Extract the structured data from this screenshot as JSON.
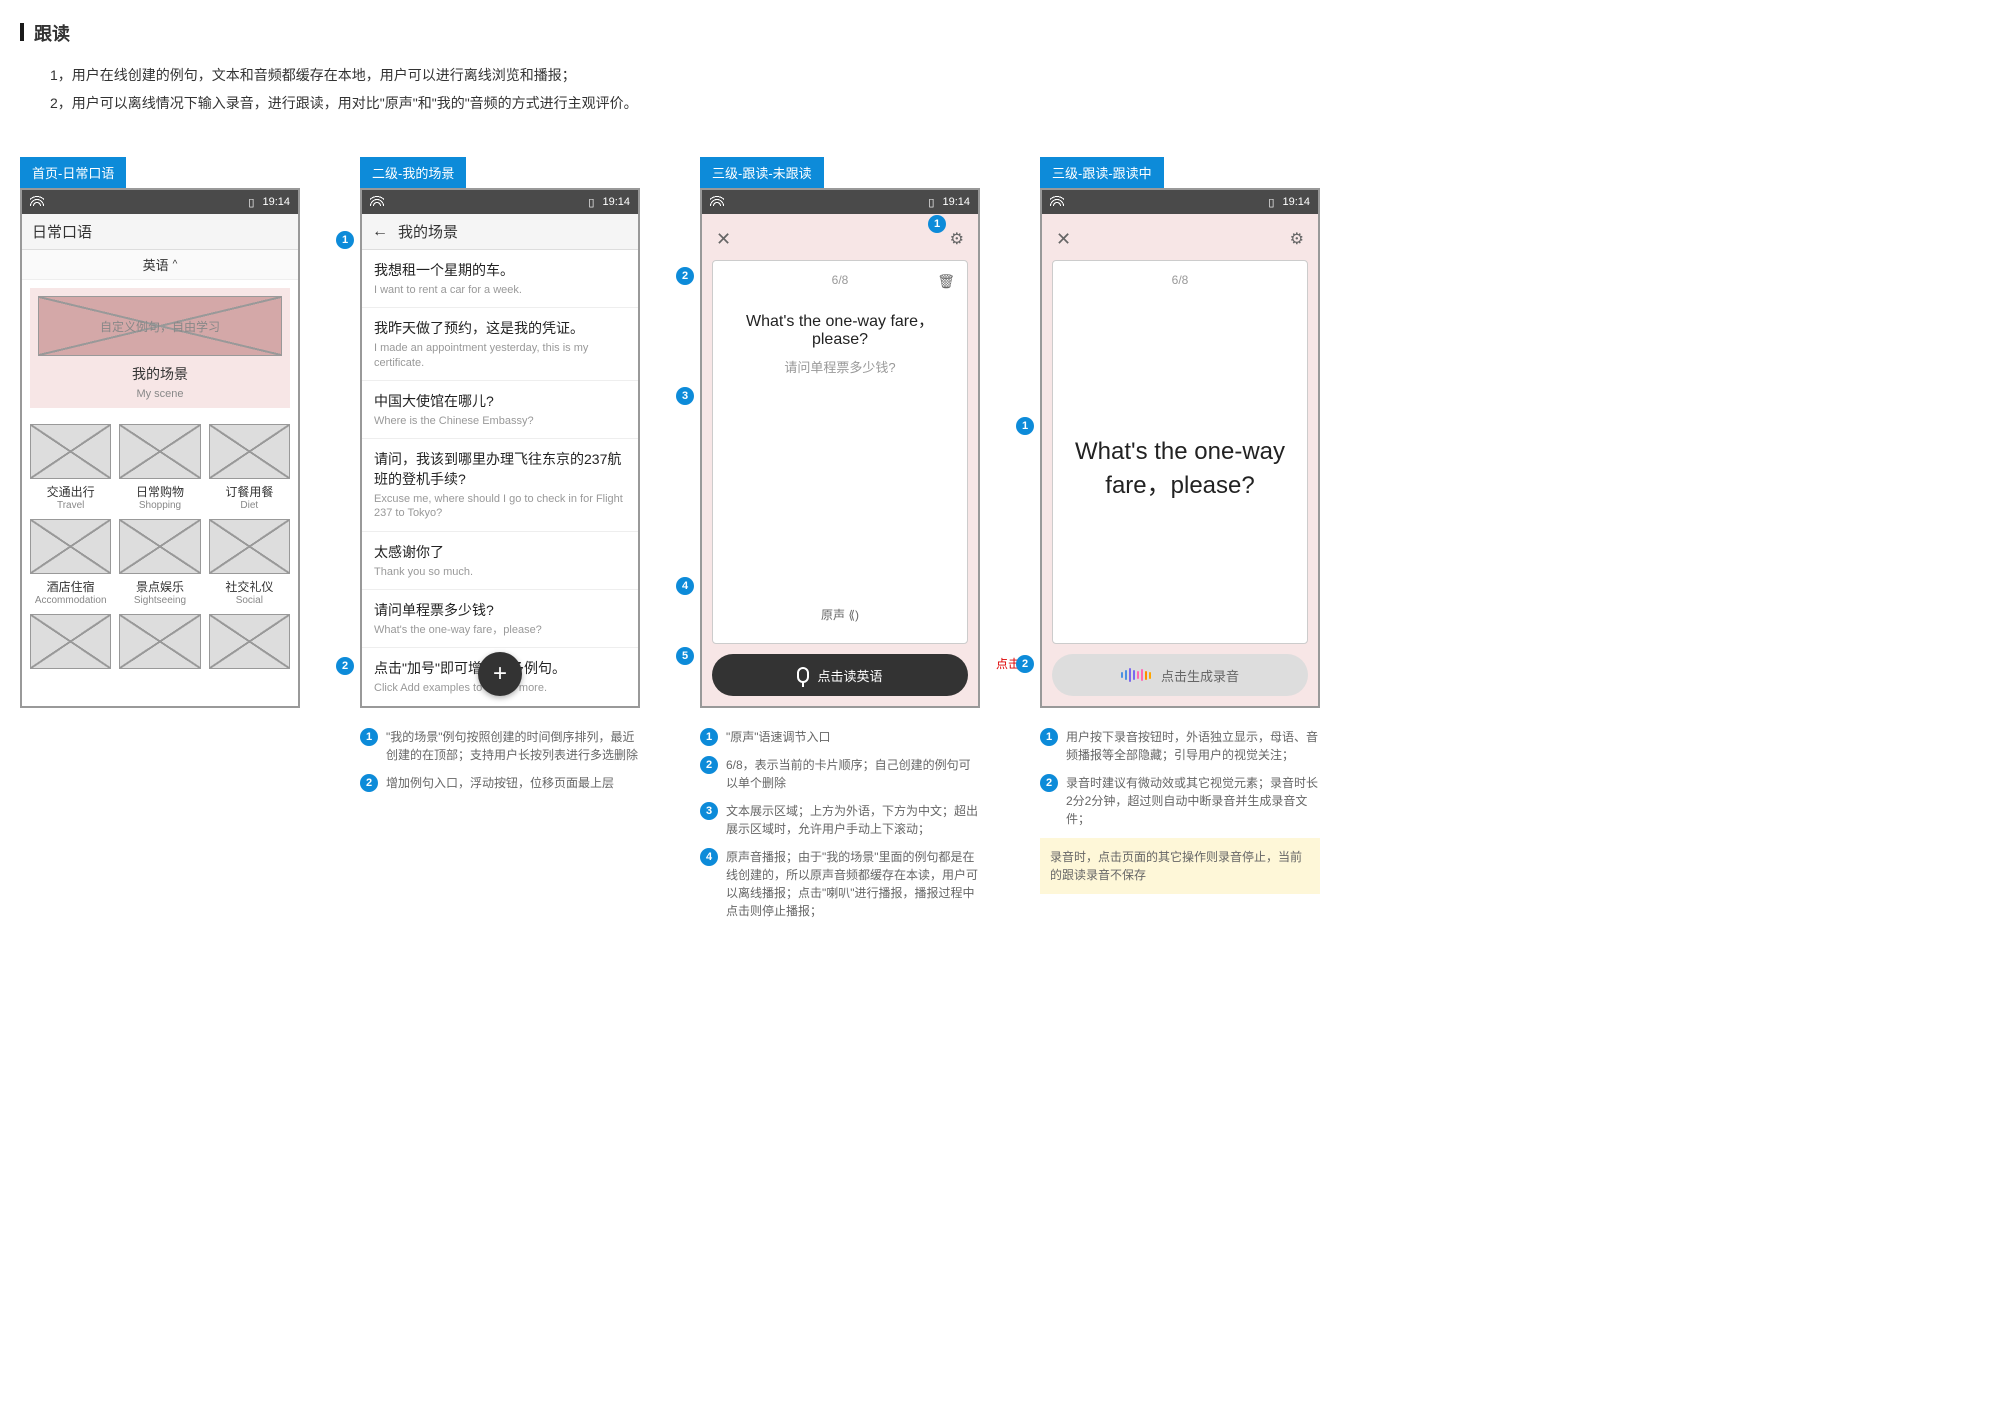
{
  "section": {
    "title": "跟读"
  },
  "intro": {
    "line1": "1，用户在线创建的例句，文本和音频都缓存在本地，用户可以进行离线浏览和播报；",
    "line2": "2，用户可以离线情况下输入录音，进行跟读，用对比\"原声\"和\"我的\"音频的方式进行主观评价。"
  },
  "status": {
    "time": "19:14"
  },
  "panels": {
    "p1": {
      "label": "首页-日常口语",
      "header": "日常口语",
      "lang": "英语",
      "banner": "自定义例句，自由学习",
      "scene_zh": "我的场景",
      "scene_en": "My scene",
      "cats": [
        {
          "zh": "交通出行",
          "en": "Travel"
        },
        {
          "zh": "日常购物",
          "en": "Shopping"
        },
        {
          "zh": "订餐用餐",
          "en": "Diet"
        },
        {
          "zh": "酒店住宿",
          "en": "Accommodation"
        },
        {
          "zh": "景点娱乐",
          "en": "Sightseeing"
        },
        {
          "zh": "社交礼仪",
          "en": "Social"
        }
      ]
    },
    "p2": {
      "label": "二级-我的场景",
      "header": "我的场景",
      "items": [
        {
          "zh": "我想租一个星期的车。",
          "en": "I want to rent a car for a week."
        },
        {
          "zh": "我昨天做了预约，这是我的凭证。",
          "en": "I made an appointment yesterday, this is my certificate."
        },
        {
          "zh": "中国大使馆在哪儿?",
          "en": "Where is the Chinese Embassy?"
        },
        {
          "zh": "请问，我该到哪里办理飞往东京的237航班的登机手续?",
          "en": "Excuse me, where should I go to check in for Flight 237 to Tokyo?"
        },
        {
          "zh": "太感谢你了",
          "en": "Thank you so much."
        },
        {
          "zh": "请问单程票多少钱?",
          "en": "What's the one-way fare，please?"
        }
      ],
      "hint": {
        "zh": "点击\"加号\"即可增加更多例句。",
        "en": "Click Add examples to create more."
      },
      "annos": [
        "\"我的场景\"例句按照创建的时间倒序排列，最近创建的在顶部；支持用户长按列表进行多选删除",
        "增加例句入口，浮动按钮，位移页面最上层"
      ]
    },
    "p3": {
      "label": "三级-跟读-未跟读",
      "counter": "6/8",
      "main_en": "What's the one-way fare，please?",
      "main_zh": "请问单程票多少钱?",
      "audio_label": "原声",
      "rec_label": "点击读英语",
      "click_label": "点击",
      "annos": [
        "\"原声\"语速调节入口",
        "6/8，表示当前的卡片顺序；自己创建的例句可以单个删除",
        "文本展示区域；上方为外语，下方为中文；超出展示区域时，允许用户手动上下滚动；",
        "原声音播报；由于\"我的场景\"里面的例句都是在线创建的，所以原声音频都缓存在本读，用户可以离线播报；点击\"喇叭\"进行播报，播报过程中点击则停止播报；"
      ]
    },
    "p4": {
      "label": "三级-跟读-跟读中",
      "counter": "6/8",
      "big_text": "What's the one-way fare，please?",
      "gen_label": "点击生成录音",
      "annos": [
        "用户按下录音按钮时，外语独立显示，母语、音频播报等全部隐藏；引导用户的视觉关注；",
        "录音时建议有微动效或其它视觉元素；录音时长2分2分钟，超过则自动中断录音并生成录音文件；"
      ],
      "yellow": "录音时，点击页面的其它操作则录音停止，当前的跟读录音不保存"
    }
  },
  "wave_colors": [
    "#4a90e2",
    "#4a90e2",
    "#7b68ee",
    "#7b68ee",
    "#ff69b4",
    "#ff69b4",
    "#ff8c00",
    "#ffa500"
  ]
}
